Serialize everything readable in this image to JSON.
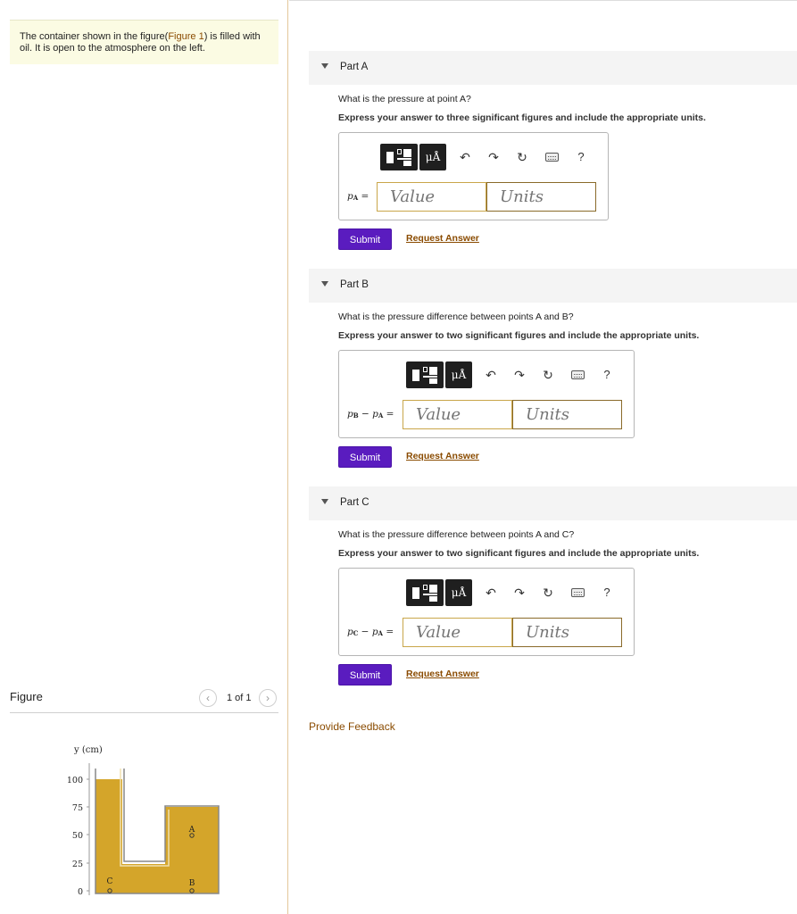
{
  "intro": {
    "text_before": "The container shown in the figure(",
    "figure_link": "Figure 1",
    "text_after": ") is filled with oil. It is open to the atmosphere on the left."
  },
  "figure_panel": {
    "title": "Figure",
    "page_count": "1 of 1",
    "prev_icon": "chevron-left-icon",
    "next_icon": "chevron-right-icon"
  },
  "figure": {
    "y_axis_label": "y (cm)",
    "y_ticks": [
      "100",
      "75",
      "50",
      "25",
      "0"
    ],
    "point_labels": {
      "A": "A",
      "B": "B",
      "C": "C"
    },
    "fluid_color": "#d4a52a"
  },
  "toolbar": {
    "unit_label": "μÅ",
    "undo_icon": "undo-icon",
    "redo_icon": "redo-icon",
    "reset_icon": "reset-icon",
    "keyboard_icon": "keyboard-icon",
    "help_label": "?"
  },
  "parts": [
    {
      "title": "Part A",
      "question": "What is the pressure at point A?",
      "instruction": "Express your answer to three significant figures and include the appropriate units.",
      "eq_main": "p",
      "eq_sub": "A",
      "eq_equals": "=",
      "value_placeholder": "Value",
      "units_placeholder": "Units",
      "submit_label": "Submit",
      "request_label": "Request Answer"
    },
    {
      "title": "Part B",
      "question": "What is the pressure difference between points A and B?",
      "instruction": "Express your answer to two significant figures and include the appropriate units.",
      "eq_main1": "p",
      "eq_sub1": "B",
      "eq_minus": "−",
      "eq_main2": "p",
      "eq_sub2": "A",
      "eq_equals": "=",
      "value_placeholder": "Value",
      "units_placeholder": "Units",
      "submit_label": "Submit",
      "request_label": "Request Answer"
    },
    {
      "title": "Part C",
      "question": "What is the pressure difference between points A and C?",
      "instruction": "Express your answer to two significant figures and include the appropriate units.",
      "eq_main1": "p",
      "eq_sub1": "C",
      "eq_minus": "−",
      "eq_main2": "p",
      "eq_sub2": "A",
      "eq_equals": "=",
      "value_placeholder": "Value",
      "units_placeholder": "Units",
      "submit_label": "Submit",
      "request_label": "Request Answer"
    }
  ],
  "feedback_label": "Provide Feedback",
  "colors": {
    "submit": "#5a1cbf",
    "link": "#8a4b00",
    "input_border": "#c9a64a"
  }
}
